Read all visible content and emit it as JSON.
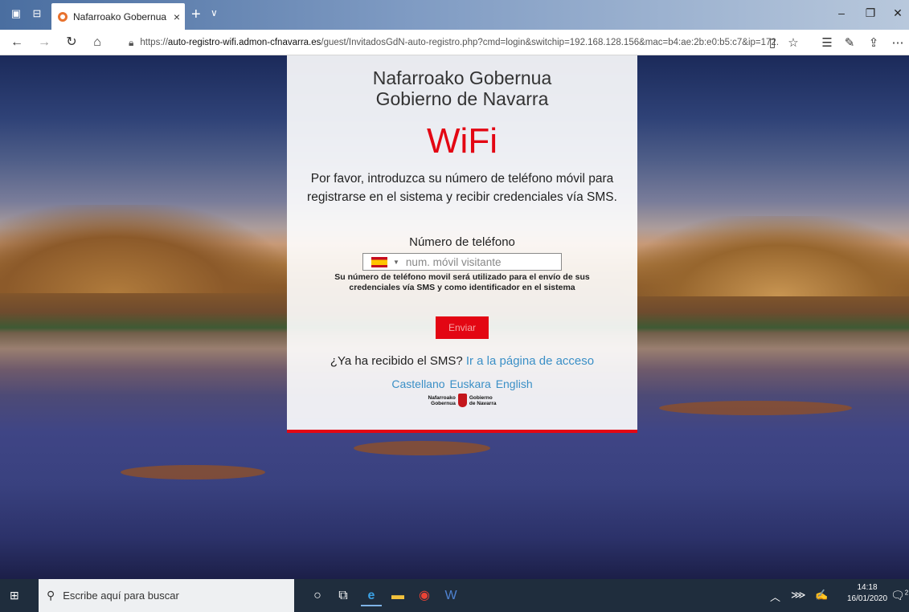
{
  "browser": {
    "tab_title": "Nafarroako Gobernua -",
    "tab_close": "×",
    "new_tab": "+",
    "tab_menu": "∨",
    "url_prefix": "https://",
    "url_host": "auto-registro-wifi.admon-cfnavarra.es",
    "url_rest": "/guest/InvitadosGdN-auto-registro.php?cmd=login&switchip=192.168.128.156&mac=b4:ae:2b:e0:b5:c7&ip=172."
  },
  "page": {
    "org_basque": "Nafarroako Gobernua",
    "org_spanish": "Gobierno de Navarra",
    "wifi_title": "WiFi",
    "intro_line1": "Por favor, introduzca su número de teléfono móvil para",
    "intro_line2": "registrarse en el sistema y recibir credenciales vía SMS.",
    "phone_label": "Número de teléfono",
    "phone_placeholder": "num. móvil visitante",
    "phone_value": "",
    "help_line1": "Su número de teléfono movil será utilizado para el envío de sus",
    "help_line2": "credenciales vía SMS y como identificador en el sistema",
    "send_button": "Enviar",
    "sms_question": "¿Ya ha recibido el SMS?",
    "access_link": "Ir a la página de acceso",
    "languages": [
      "Castellano",
      "Euskara",
      "English"
    ],
    "logo_left_line1": "Nafarroako",
    "logo_left_line2": "Gobernua",
    "logo_right_line1": "Gobierno",
    "logo_right_line2": "de Navarra",
    "accent_color": "#e30613",
    "link_color": "#3a8fc6"
  },
  "taskbar": {
    "search_placeholder": "Escribe aquí para buscar",
    "time": "14:18",
    "date": "16/01/2020",
    "notification_count": "2"
  }
}
